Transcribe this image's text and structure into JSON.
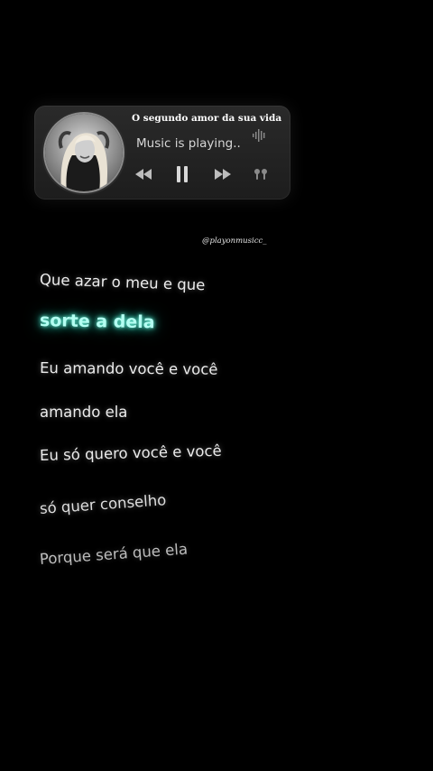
{
  "player": {
    "song_title": "O segundo amor da sua vida",
    "status": "Music is playing..",
    "icons": {
      "album": "album-art",
      "wave": "sound-wave-icon",
      "rewind": "rewind-icon",
      "pause": "pause-icon",
      "forward": "fast-forward-icon",
      "earbuds": "earbuds-icon"
    }
  },
  "credit": "@playonmusicc_",
  "lyrics": [
    "Que azar o meu e que",
    "sorte a dela",
    "Eu amando você e você",
    "amando ela",
    "Eu só quero você e você",
    "só quer conselho",
    "Porque será que ela"
  ],
  "active_line": 1,
  "colors": {
    "background": "#000000",
    "highlight": "#b4fff2",
    "glow": "#37e4c6"
  }
}
